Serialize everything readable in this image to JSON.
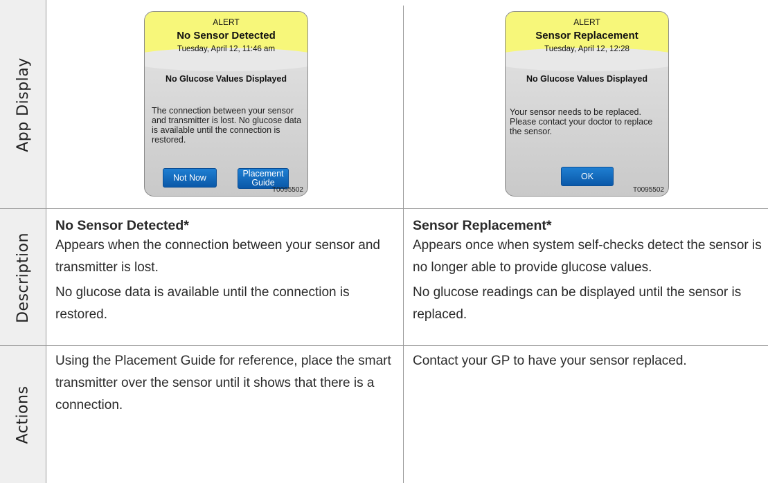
{
  "rows": {
    "app_display": "App Display",
    "description": "Description",
    "actions": "Actions"
  },
  "left": {
    "screen": {
      "alert": "ALERT",
      "title": "No Sensor Detected",
      "date": "Tuesday, April 12, 11:46 am",
      "subtitle": "No Glucose Values Displayed",
      "message": "The connection between your sensor and transmitter is lost. No glucose data is available until the connection is restored.",
      "button_not_now": "Not Now",
      "button_placement_guide": "Placement Guide",
      "code": "T0095502"
    },
    "desc_title": "No Sensor Detected*",
    "desc_p1": "Appears when the connection between your sensor and transmitter is lost.",
    "desc_p2": "No glucose data is available until the connection is restored.",
    "action": "Using the Placement Guide for reference, place the smart transmitter over the sensor until it shows that there is a connection."
  },
  "right": {
    "screen": {
      "alert": "ALERT",
      "title": "Sensor Replacement",
      "date": "Tuesday, April 12, 12:28",
      "subtitle": "No Glucose Values Displayed",
      "message": "Your sensor needs to be replaced. Please contact your doctor to replace the sensor.",
      "button_ok": "OK",
      "code": "T0095502"
    },
    "desc_title": "Sensor Replacement*",
    "desc_p1": "Appears once when system self-checks detect the sensor is no longer able to provide glucose values.",
    "desc_p2": "No glucose readings can be displayed until the sensor is replaced.",
    "action": "Contact your GP to have your sensor replaced."
  }
}
